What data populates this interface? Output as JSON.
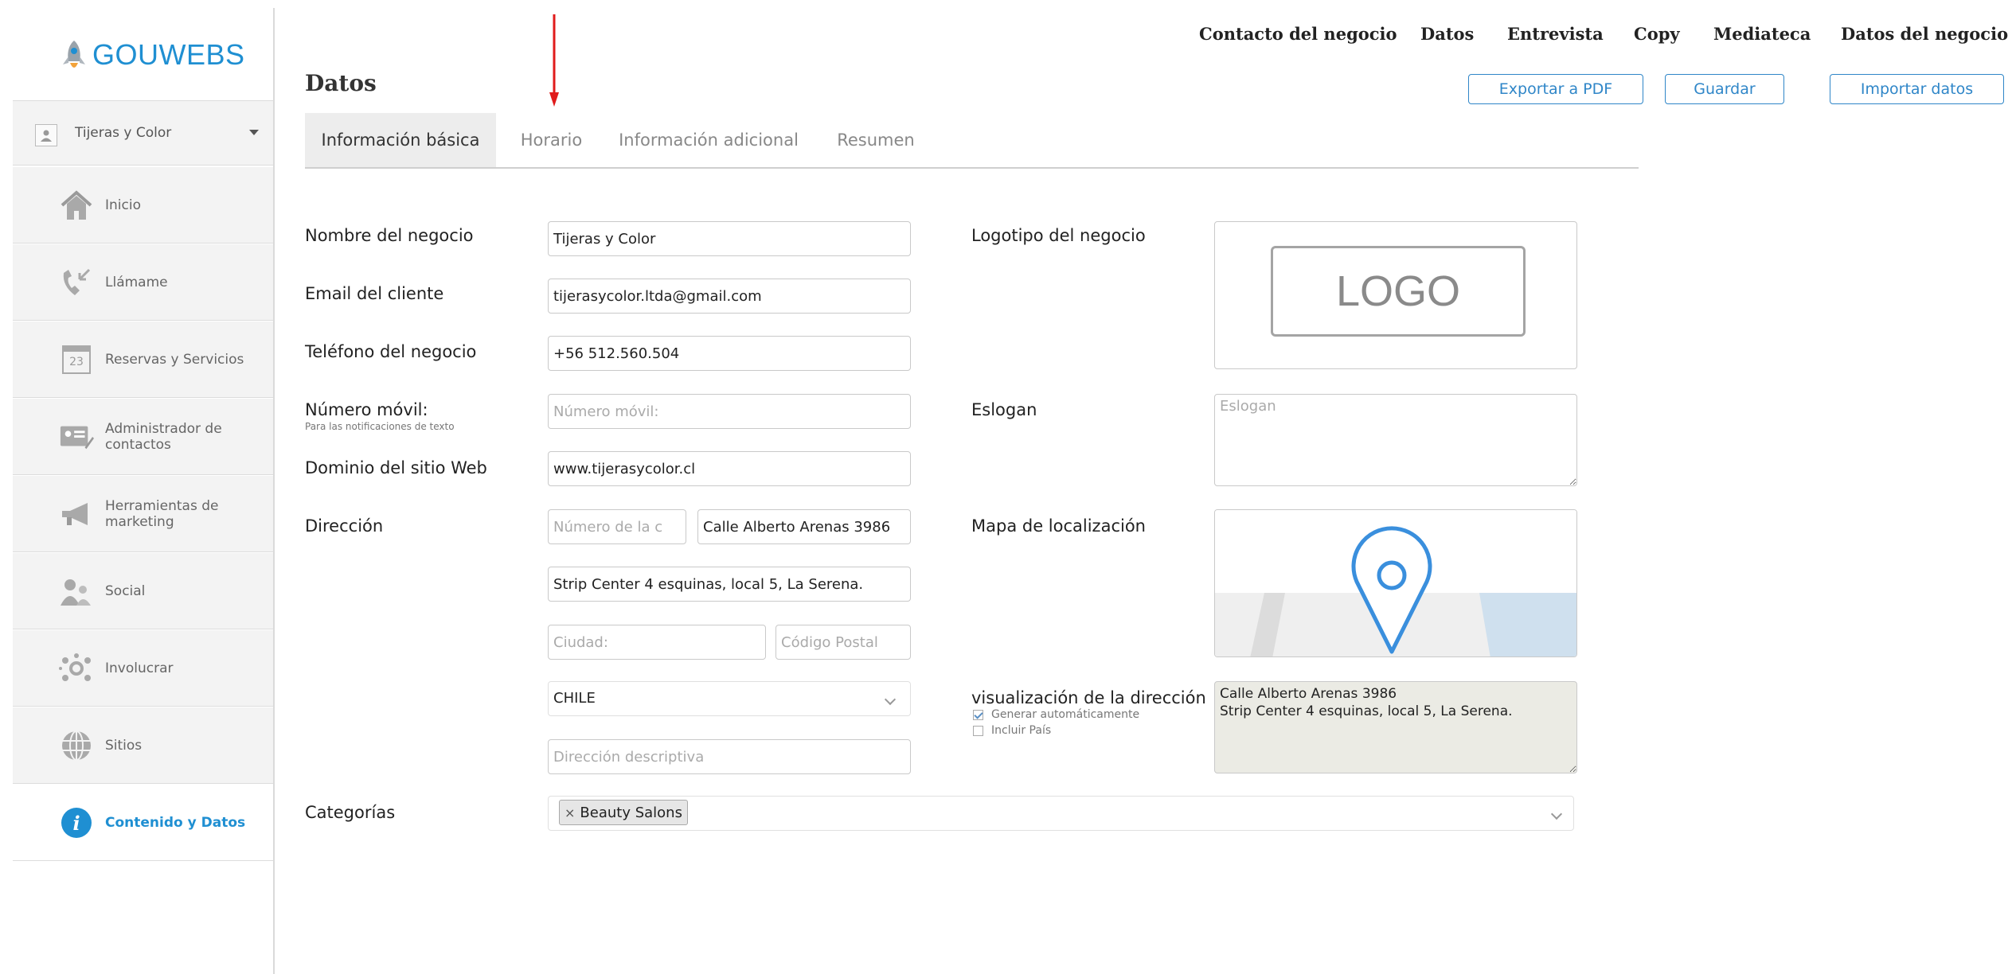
{
  "brand": {
    "name": "GOUWEBS",
    "color": "#1f8fd2"
  },
  "account": {
    "name": "Tijeras y Color"
  },
  "sidebar": {
    "items": [
      {
        "label": "Inicio",
        "icon": "home-icon"
      },
      {
        "label": "Llámame",
        "icon": "phone-icon"
      },
      {
        "label": "Reservas y Servicios",
        "icon": "calendar-icon",
        "calendar_day": "23"
      },
      {
        "label": "Administrador de contactos",
        "icon": "contact-card-icon"
      },
      {
        "label": "Herramientas de marketing",
        "icon": "megaphone-icon"
      },
      {
        "label": "Social",
        "icon": "people-icon"
      },
      {
        "label": "Involucrar",
        "icon": "network-icon"
      },
      {
        "label": "Sitios",
        "icon": "globe-icon"
      },
      {
        "label": "Contenido y Datos",
        "icon": "info-icon",
        "active": true
      }
    ]
  },
  "top_nav": [
    "Contacto del negocio",
    "Datos",
    "Entrevista",
    "Copy",
    "Mediateca",
    "Datos del negocio"
  ],
  "header": {
    "title": "Datos",
    "buttons": {
      "export": "Exportar a PDF",
      "save": "Guardar",
      "import": "Importar datos"
    }
  },
  "tabs": [
    {
      "label": "Información básica",
      "active": true
    },
    {
      "label": "Horario"
    },
    {
      "label": "Información adicional"
    },
    {
      "label": "Resumen"
    }
  ],
  "form": {
    "business_name": {
      "label": "Nombre del negocio",
      "value": "Tijeras y Color"
    },
    "client_email": {
      "label": "Email del cliente",
      "value": "tijerasycolor.ltda@gmail.com"
    },
    "business_phone": {
      "label": "Teléfono del negocio",
      "value": "+56 512.560.504"
    },
    "mobile": {
      "label": "Número móvil:",
      "sublabel": "Para las notificaciones de texto",
      "placeholder": "Número móvil:",
      "value": ""
    },
    "domain": {
      "label": "Dominio del sitio Web",
      "value": "www.tijerasycolor.cl"
    },
    "address": {
      "label": "Dirección",
      "number_placeholder": "Número de la c",
      "street": "Calle Alberto Arenas 3986",
      "line2": "Strip Center 4 esquinas, local 5, La Serena.",
      "city_placeholder": "Ciudad:",
      "postal_placeholder": "Código Postal",
      "country": "CHILE",
      "descriptive_placeholder": "Dirección descriptiva"
    },
    "logo": {
      "label": "Logotipo del negocio",
      "placeholder_text": "LOGO"
    },
    "slogan": {
      "label": "Eslogan",
      "placeholder": "Eslogan",
      "value": ""
    },
    "map": {
      "label": "Mapa de localización",
      "pin_color": "#3a8fdd"
    },
    "address_display": {
      "label": "visualización de la dirección",
      "auto_generate": {
        "label": "Generar automáticamente",
        "checked": true
      },
      "include_country": {
        "label": "Incluir País",
        "checked": false
      },
      "value": "Calle Alberto Arenas 3986\nStrip Center 4 esquinas, local 5, La Serena."
    },
    "categories": {
      "label": "Categorías",
      "tags": [
        "Beauty Salons"
      ]
    }
  },
  "annotation": {
    "color": "#e01b1b"
  }
}
